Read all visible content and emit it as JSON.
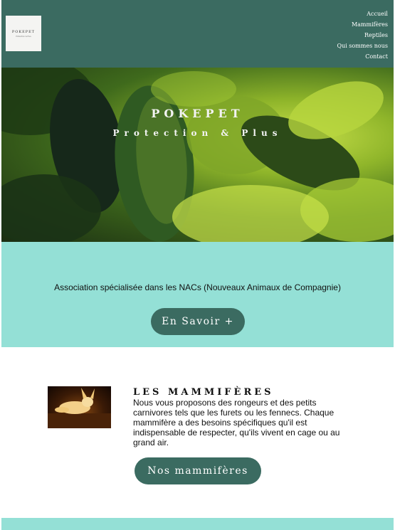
{
  "header": {
    "logo": {
      "title": "POKEPET",
      "subtitle": "Protection & Plus"
    },
    "nav": [
      "Accueil",
      "Mammifères",
      "Reptiles",
      "Qui sommes nous",
      "Contact"
    ]
  },
  "hero": {
    "title": "POKEPET",
    "subtitle": "Protection & Plus"
  },
  "intro": {
    "text": "Association spécialisée dans les NACs (Nouveaux Animaux de Compagnie)",
    "button": "En Savoir +"
  },
  "mammals": {
    "title": "LES MAMMIFÈRES",
    "text": "Nous vous proposons des rongeurs et des petits carnivores tels que les furets ou les fennecs. Chaque mammifère a des besoins spécifiques qu'il est indispensable de respecter, qu'ils vivent en cage ou au grand air.",
    "button": "Nos mammifères"
  },
  "colors": {
    "header_bg": "#3b6b61",
    "accent_band": "#94e0d6",
    "button_bg": "#3b6b61"
  }
}
